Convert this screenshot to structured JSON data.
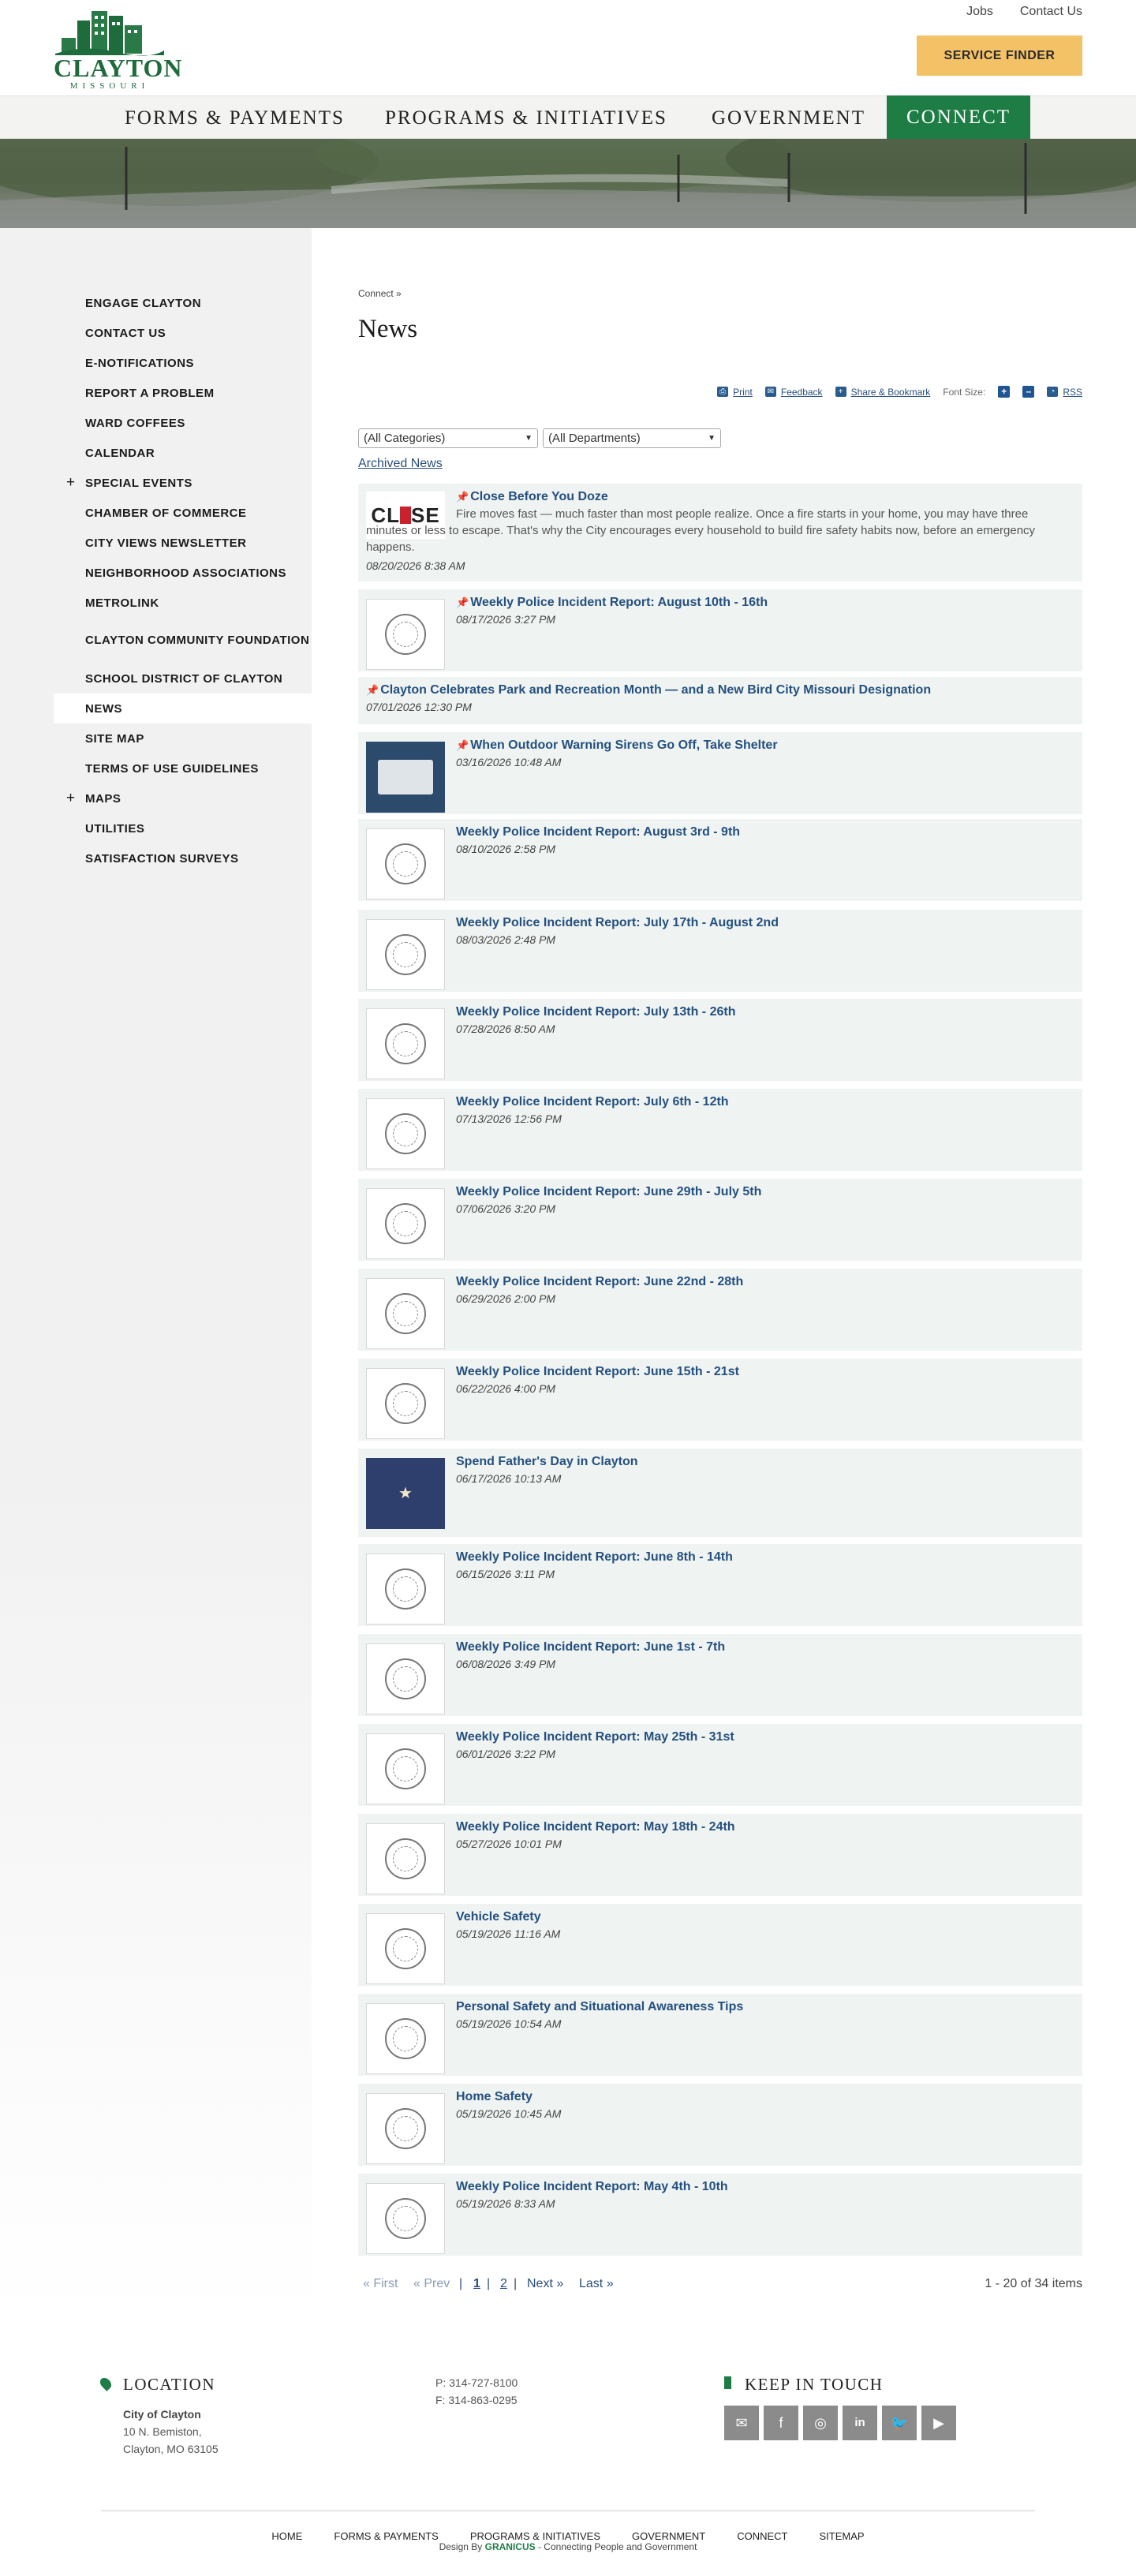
{
  "header": {
    "logo_text": "CLAYTON",
    "logo_sub": "MISSOURI",
    "top_links": [
      "Jobs",
      "Contact Us"
    ],
    "service_finder": "SERVICE FINDER"
  },
  "nav": [
    "FORMS & PAYMENTS",
    "PROGRAMS & INITIATIVES",
    "GOVERNMENT",
    "CONNECT"
  ],
  "sidebar": [
    {
      "label": "ENGAGE CLAYTON",
      "plus": false
    },
    {
      "label": "CONTACT US",
      "plus": false
    },
    {
      "label": "E-NOTIFICATIONS",
      "plus": false
    },
    {
      "label": "REPORT A PROBLEM",
      "plus": false
    },
    {
      "label": "WARD COFFEES",
      "plus": false
    },
    {
      "label": "CALENDAR",
      "plus": false
    },
    {
      "label": "SPECIAL EVENTS",
      "plus": true
    },
    {
      "label": "CHAMBER OF COMMERCE",
      "plus": false
    },
    {
      "label": "CITY VIEWS NEWSLETTER",
      "plus": false
    },
    {
      "label": "NEIGHBORHOOD ASSOCIATIONS",
      "plus": false
    },
    {
      "label": "METROLINK",
      "plus": false
    },
    {
      "label": "CLAYTON COMMUNITY FOUNDATION",
      "plus": false
    },
    {
      "label": "SCHOOL DISTRICT OF CLAYTON",
      "plus": false
    },
    {
      "label": "NEWS",
      "plus": false
    },
    {
      "label": "SITE MAP",
      "plus": false
    },
    {
      "label": "TERMS OF USE GUIDELINES",
      "plus": false
    },
    {
      "label": "MAPS",
      "plus": true
    },
    {
      "label": "UTILITIES",
      "plus": false
    },
    {
      "label": "SATISFACTION SURVEYS",
      "plus": false
    }
  ],
  "breadcrumb": "Connect »",
  "page_title": "News",
  "tools": {
    "print": "Print",
    "feedback": "Feedback",
    "share": "Share & Bookmark",
    "font_size": "Font Size:",
    "plus": "+",
    "minus": "–",
    "rss": "RSS"
  },
  "filters": {
    "categories": "(All Categories)",
    "departments": "(All Departments)"
  },
  "archived": "Archived News",
  "news": [
    {
      "title": "Close Before You Doze",
      "date": "08/20/2026 8:38 AM",
      "pinned": true,
      "thumb": "close",
      "desc": "Fire moves fast — much faster than most people realize. Once a fire starts in your home, you may have three minutes or less to escape. That's why the City encourages every household to build fire safety habits now, before an emergency happens."
    },
    {
      "title": "Weekly Police Incident Report: August 10th - 16th",
      "date": "08/17/2026 3:27 PM",
      "pinned": true,
      "thumb": "seal"
    },
    {
      "title": "Clayton Celebrates Park and Recreation Month — and a New Bird City Missouri Designation",
      "date": "07/01/2026 12:30 PM",
      "pinned": true,
      "thumb": "none"
    },
    {
      "title": "When Outdoor Warning Sirens Go Off, Take Shelter",
      "date": "03/16/2026 10:48 AM",
      "pinned": true,
      "thumb": "siren"
    },
    {
      "title": "Weekly Police Incident Report: August 3rd - 9th",
      "date": "08/10/2026 2:58 PM",
      "pinned": false,
      "thumb": "seal"
    },
    {
      "title": "Weekly Police Incident Report: July 17th - August 2nd",
      "date": "08/03/2026 2:48 PM",
      "pinned": false,
      "thumb": "seal"
    },
    {
      "title": "Weekly Police Incident Report: July 13th - 26th",
      "date": "07/28/2026 8:50 AM",
      "pinned": false,
      "thumb": "seal"
    },
    {
      "title": "Weekly Police Incident Report: July 6th - 12th",
      "date": "07/13/2026 12:56 PM",
      "pinned": false,
      "thumb": "seal"
    },
    {
      "title": "Weekly Police Incident Report: June 29th - July 5th",
      "date": "07/06/2026 3:20 PM",
      "pinned": false,
      "thumb": "seal"
    },
    {
      "title": "Weekly Police Incident Report: June 22nd - 28th",
      "date": "06/29/2026 2:00 PM",
      "pinned": false,
      "thumb": "seal"
    },
    {
      "title": "Weekly Police Incident Report: June 15th - 21st",
      "date": "06/22/2026 4:00 PM",
      "pinned": false,
      "thumb": "seal"
    },
    {
      "title": "Spend Father's Day in Clayton",
      "date": "06/17/2026 10:13 AM",
      "pinned": false,
      "thumb": "dad"
    },
    {
      "title": "Weekly Police Incident Report: June 8th - 14th",
      "date": "06/15/2026 3:11 PM",
      "pinned": false,
      "thumb": "seal"
    },
    {
      "title": "Weekly Police Incident Report: June 1st - 7th",
      "date": "06/08/2026 3:49 PM",
      "pinned": false,
      "thumb": "seal"
    },
    {
      "title": "Weekly Police Incident Report: May 25th - 31st",
      "date": "06/01/2026 3:22 PM",
      "pinned": false,
      "thumb": "seal"
    },
    {
      "title": "Weekly Police Incident Report: May 18th - 24th",
      "date": "05/27/2026 10:01 PM",
      "pinned": false,
      "thumb": "seal"
    },
    {
      "title": "Vehicle Safety",
      "date": "05/19/2026 11:16 AM",
      "pinned": false,
      "thumb": "seal"
    },
    {
      "title": "Personal Safety and Situational Awareness Tips",
      "date": "05/19/2026 10:54 AM",
      "pinned": false,
      "thumb": "seal"
    },
    {
      "title": "Home Safety",
      "date": "05/19/2026 10:45 AM",
      "pinned": false,
      "thumb": "seal"
    },
    {
      "title": "Weekly Police Incident Report: May 4th - 10th",
      "date": "05/19/2026 8:33 AM",
      "pinned": false,
      "thumb": "seal"
    }
  ],
  "pager": {
    "first": "« First",
    "prev": "« Prev",
    "sep": "|",
    "page1": "1",
    "page2": "2",
    "next": "Next »",
    "last": "Last »",
    "count": "1 - 20 of 34 items"
  },
  "footer": {
    "location_title": "LOCATION",
    "org": "City of Clayton",
    "address1": "10 N. Bemiston,",
    "address2": "Clayton, MO 63105",
    "phone": "P: 314-727-8100",
    "fax": "F: 314-863-0295",
    "keep_title": "KEEP IN TOUCH",
    "nav": [
      "HOME",
      "FORMS & PAYMENTS",
      "PROGRAMS & INITIATIVES",
      "GOVERNMENT",
      "CONNECT",
      "SITEMAP"
    ],
    "credit_pre": "Design By",
    "credit_brand": "GRANICUS",
    "credit_post": "- Connecting People and Government"
  },
  "colors": {
    "brand_green": "#1e7d45",
    "service_gold": "#f4c266",
    "link_blue": "#24507f",
    "card_bg": "#eff3f2"
  }
}
